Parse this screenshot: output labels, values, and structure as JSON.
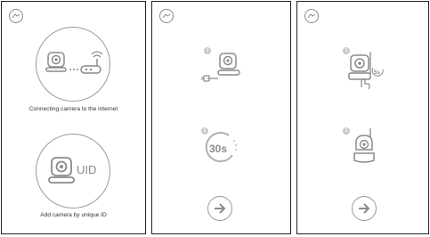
{
  "panel1": {
    "option_internet": {
      "label": "Connecting camera to the internet",
      "icon": "camera-router-icon"
    },
    "option_uid": {
      "label": "Add camera by unique ID",
      "icon_text": "UID",
      "icon": "camera-uid-icon"
    }
  },
  "panel2": {
    "step1": {
      "number": "1",
      "icon": "camera-power-plug-icon"
    },
    "step2": {
      "number": "2",
      "timer_text": "30s",
      "icon": "timer-icon"
    },
    "next": {
      "icon": "arrow-right-icon"
    }
  },
  "panel3": {
    "step1": {
      "number": "1",
      "icon": "camera-reset-button-icon",
      "badge_text": "5s"
    },
    "step2": {
      "number": "2",
      "icon": "camera-pan-tilt-icon"
    },
    "next": {
      "icon": "arrow-right-icon"
    }
  },
  "colors": {
    "icon_gray": "#8a8a8a",
    "outline": "#9a9a9a",
    "badge": "#c8c8c8",
    "frame": "#222222"
  }
}
